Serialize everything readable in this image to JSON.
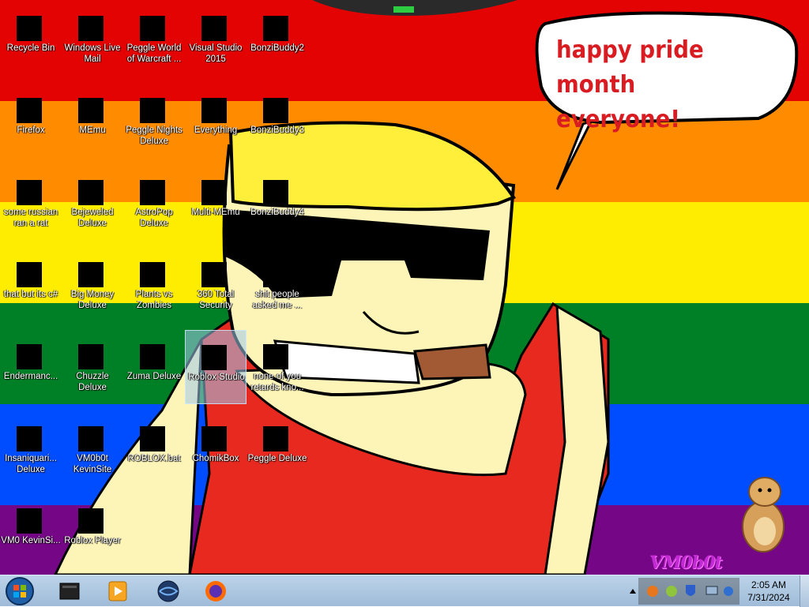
{
  "desktop": {
    "speech_bubble": "happy pride month everyone!",
    "signature": "VM0b0t",
    "icons": [
      {
        "label": "Recycle Bin",
        "icon": "recycle-bin-icon"
      },
      {
        "label": "Windows Live Mail",
        "icon": "mail-icon"
      },
      {
        "label": "Peggle World of Warcraft ...",
        "icon": "peggle-icon"
      },
      {
        "label": "Visual Studio 2015",
        "icon": "visual-studio-icon"
      },
      {
        "label": "BonziBuddy2",
        "icon": "folder-icon"
      },
      {
        "label": "Firefox",
        "icon": "firefox-icon"
      },
      {
        "label": "MEmu",
        "icon": "memu-icon"
      },
      {
        "label": "Peggle Nights Deluxe",
        "icon": "peggle-nights-icon"
      },
      {
        "label": "Everything",
        "icon": "everything-icon"
      },
      {
        "label": "BonziBuddy3",
        "icon": "bonzi-icon"
      },
      {
        "label": "some russian ran a rat",
        "icon": "file-icon"
      },
      {
        "label": "Bejeweled Deluxe",
        "icon": "bejeweled-icon"
      },
      {
        "label": "AstroPop Deluxe",
        "icon": "astropop-icon"
      },
      {
        "label": "Multi-MEmu",
        "icon": "memu-icon"
      },
      {
        "label": "BonziBuddy4",
        "icon": "bonzi-icon"
      },
      {
        "label": "that but its c#",
        "icon": "windows-stack-icon"
      },
      {
        "label": "Big Money Deluxe",
        "icon": "money-bag-icon"
      },
      {
        "label": "Plants vs Zombies",
        "icon": "plants-icon"
      },
      {
        "label": "360 Total Security",
        "icon": "security-icon"
      },
      {
        "label": "shit people asked me ...",
        "icon": "folder-icon"
      },
      {
        "label": "Endermanc...",
        "icon": "terminal-icon"
      },
      {
        "label": "Chuzzle Deluxe",
        "icon": "chuzzle-icon"
      },
      {
        "label": "Zuma Deluxe",
        "icon": "zuma-icon"
      },
      {
        "label": "Roblox Studio",
        "icon": "roblox-studio-icon"
      },
      {
        "label": "none of you retards kno...",
        "icon": "opera-icon"
      },
      {
        "label": "Insaniquari... Deluxe",
        "icon": "insaniquarium-icon"
      },
      {
        "label": "VM0b0t KevinSite",
        "icon": "shortcut-icon"
      },
      {
        "label": "ROBLOX.bat",
        "icon": "batch-file-icon"
      },
      {
        "label": "ChomikBox",
        "icon": "chomikbox-icon"
      },
      {
        "label": "Peggle Deluxe",
        "icon": "peggle-icon"
      },
      {
        "label": "VM0 KevinSi...",
        "icon": "file-icon"
      },
      {
        "label": "Roblox Player",
        "icon": "roblox-player-icon"
      }
    ]
  },
  "taskbar": {
    "pinned": [
      "folder-icon",
      "media-player-icon",
      "globe-icon",
      "firefox-icon"
    ],
    "tray_icons": [
      "up-arrow-icon",
      "orange-app-icon",
      "green-plus-icon",
      "shield-icon",
      "network-icon",
      "volume-icon"
    ],
    "clock": {
      "time": "2:05 AM",
      "date": "7/31/2024"
    }
  },
  "colors": {
    "flag": [
      "#e40303",
      "#ff8c00",
      "#ffed00",
      "#008026",
      "#004dff",
      "#750787"
    ],
    "bubble_text": "#d81c22",
    "taskbar": "#bcd4ea"
  }
}
